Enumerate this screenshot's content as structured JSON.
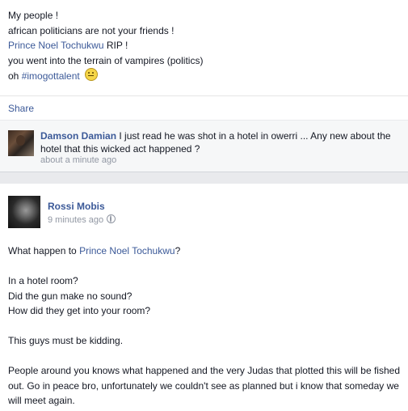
{
  "post1": {
    "lines": [
      "My people !",
      "african politicians are not your friends !"
    ],
    "rip_link": "Prince Noel Tochukwu",
    "rip_suffix": " RIP !",
    "line4": "you went into the terrain of vampires (politics)",
    "oh_prefix": "oh ",
    "hashtag": "#imogottalent",
    "emoji": "smile-emoji",
    "share_label": "Share"
  },
  "comment": {
    "author": "Damson Damian",
    "text": " I just read he was shot in a hotel in owerri ... Any new about the hotel that this wicked act happened ?",
    "time": "about a minute ago"
  },
  "post2": {
    "author": "Rossi Mobis",
    "time": "9 minutes ago",
    "privacy_icon": "globe-icon",
    "q_prefix": "What happen to ",
    "q_link": "Prince Noel Tochukwu",
    "q_suffix": "?",
    "lines": [
      "In a hotel room?",
      "Did the gun make no sound?",
      "How did they get into your room?"
    ],
    "kidding": "This guys must be kidding.",
    "closing": "People around you knows what happened and the very Judas that plotted this will be fished out. Go in peace bro, unfortunately we couldn't see as planned but i know that someday we will meet again."
  }
}
